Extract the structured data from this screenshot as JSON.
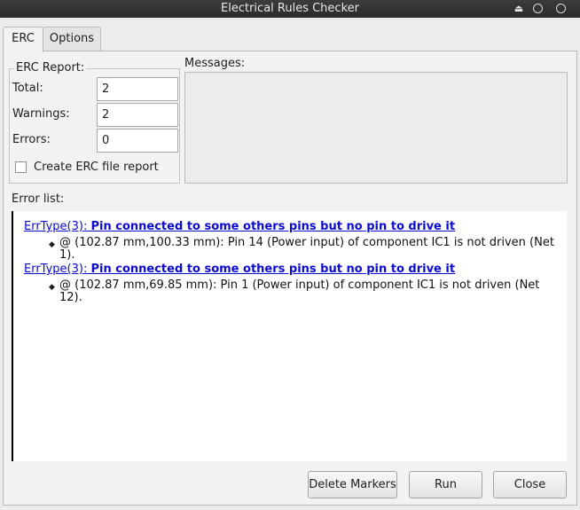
{
  "window": {
    "title": "Electrical Rules Checker"
  },
  "tabs": [
    {
      "label": "ERC"
    },
    {
      "label": "Options"
    }
  ],
  "report": {
    "group_title": "ERC Report:",
    "total_label": "Total:",
    "total_value": "2",
    "warnings_label": "Warnings:",
    "warnings_value": "2",
    "errors_label": "Errors:",
    "errors_value": "0",
    "create_report_label": "Create ERC file report",
    "create_report_checked": false
  },
  "messages": {
    "label": "Messages:",
    "content": ""
  },
  "error_list": {
    "label": "Error list:",
    "items": [
      {
        "type": "ErrType(3):",
        "title": "Pin connected to some others pins but no pin to drive it",
        "detail_line1": "@ (102.87 mm,100.33 mm): Pin 14 (Power input) of component IC1 is not driven (Net",
        "detail_line2": "1)."
      },
      {
        "type": "ErrType(3):",
        "title": "Pin connected to some others pins but no pin to drive it",
        "detail_line1": "@ (102.87 mm,69.85 mm): Pin 1 (Power input) of component IC1 is not driven (Net",
        "detail_line2": "12)."
      }
    ]
  },
  "buttons": {
    "delete_markers": "Delete Markers",
    "run": "Run",
    "close": "Close"
  }
}
